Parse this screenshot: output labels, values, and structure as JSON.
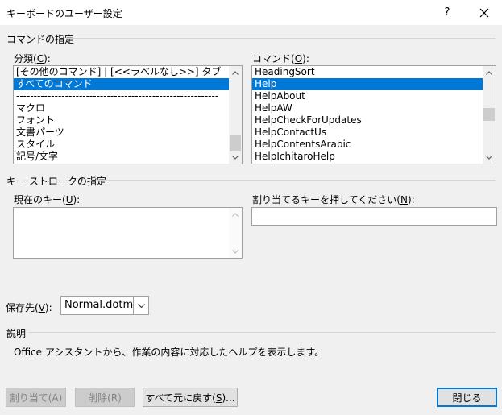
{
  "window": {
    "title": "キーボードのユーザー設定",
    "help_label": "?"
  },
  "commands_group": {
    "label": "コマンドの指定",
    "categories": {
      "label": "分類(C):",
      "items": [
        "[その他のコマンド] | [<<ラベルなし>>] タブ",
        "すべてのコマンド",
        "----------------------------------------------------------",
        "マクロ",
        "フォント",
        "文書パーツ",
        "スタイル",
        "記号/文字"
      ],
      "selected_index": 1
    },
    "commands": {
      "label": "コマンド(O):",
      "items": [
        "HeadingSort",
        "Help",
        "HelpAbout",
        "HelpAW",
        "HelpCheckForUpdates",
        "HelpContactUs",
        "HelpContentsArabic",
        "HelpIchitaroHelp"
      ],
      "selected_index": 1
    }
  },
  "keystroke_group": {
    "label": "キー ストロークの指定",
    "current_keys_label": "現在のキー(U):",
    "new_key_label": "割り当てるキーを押してください(N):",
    "new_key_value": ""
  },
  "save_in": {
    "label": "保存先(V):",
    "value": "Normal.dotm"
  },
  "description": {
    "label": "説明",
    "text": "Office アシスタントから、作業の内容に対応したヘルプを表示します。"
  },
  "buttons": {
    "assign": "割り当て(A)",
    "remove": "削除(R)",
    "reset_all": "すべて元に戻す(S)...",
    "close": "閉じる"
  }
}
